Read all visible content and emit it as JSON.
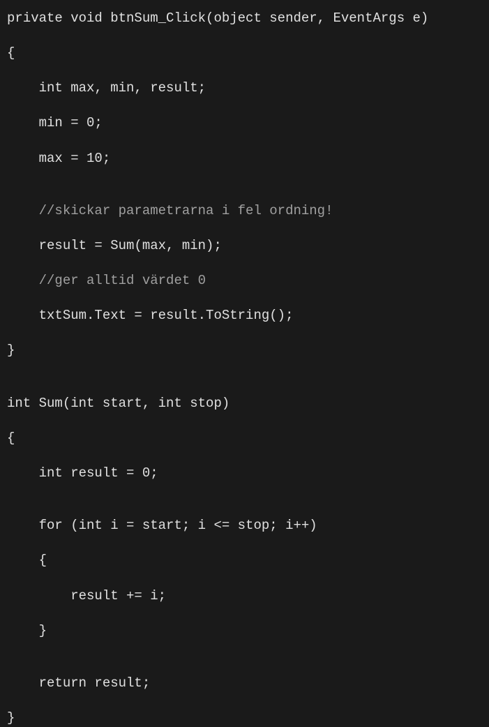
{
  "lines": [
    "private void btnSum_Click(object sender, EventArgs e)",
    "{",
    "    int max, min, result;",
    "    min = 0;",
    "    max = 10;",
    "",
    "    //skickar parametrarna i fel ordning!",
    "    result = Sum(max, min);",
    "    //ger alltid värdet 0",
    "    txtSum.Text = result.ToString();",
    "}",
    "",
    "int Sum(int start, int stop)",
    "{",
    "    int result = 0;",
    "",
    "    for (int i = start; i <= stop; i++)",
    "    {",
    "        result += i;",
    "    }",
    "",
    "    return result;",
    "}"
  ]
}
